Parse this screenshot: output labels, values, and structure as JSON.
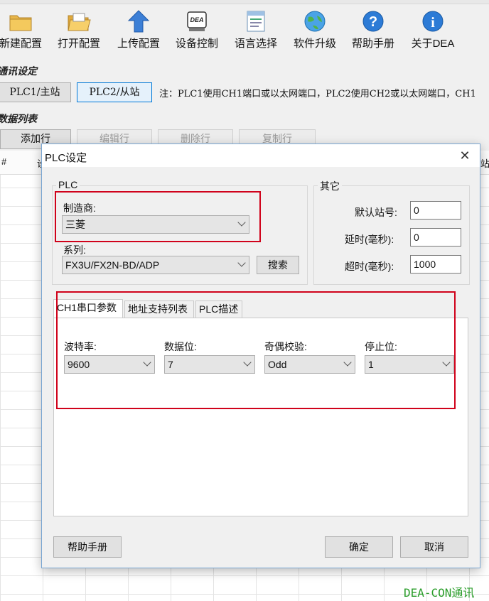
{
  "toolbar": {
    "items": [
      {
        "label": "新建配置",
        "icon": "folder-new-icon"
      },
      {
        "label": "打开配置",
        "icon": "folder-open-icon"
      },
      {
        "label": "上传配置",
        "icon": "upload-arrow-icon"
      },
      {
        "label": "设备控制",
        "icon": "dea-device-icon"
      },
      {
        "label": "语言选择",
        "icon": "language-icon"
      },
      {
        "label": "软件升级",
        "icon": "globe-icon"
      },
      {
        "label": "帮助手册",
        "icon": "help-icon"
      },
      {
        "label": "关于DEA",
        "icon": "info-icon"
      }
    ]
  },
  "comm": {
    "title": "通讯设定",
    "plc1_label": "PLC1/主站",
    "plc2_label": "PLC2/从站",
    "note": "注：PLC1使用CH1端口或以太网端口，PLC2使用CH2或以太网端口，CH1"
  },
  "datalist": {
    "title": "数据列表",
    "add_row": "添加行",
    "edit_row": "编辑行",
    "delete_row": "删除行",
    "copy_row": "复制行",
    "col_hash": "#",
    "col_partial": "设",
    "col_right_partial": "站"
  },
  "dialog": {
    "title": "PLC设定",
    "plc_group": "PLC",
    "manufacturer_label": "制造商:",
    "manufacturer_value": "三菱",
    "series_label": "系列:",
    "series_value": "FX3U/FX2N-BD/ADP",
    "search_button": "搜索",
    "other_group": "其它",
    "default_station_label": "默认站号:",
    "default_station_value": "0",
    "delay_label": "延时(毫秒):",
    "delay_value": "0",
    "timeout_label": "超时(毫秒):",
    "timeout_value": "1000",
    "tabs": [
      "CH1串口参数",
      "地址支持列表",
      "PLC描述"
    ],
    "baud_label": "波特率:",
    "baud_value": "9600",
    "databits_label": "数据位:",
    "databits_value": "7",
    "parity_label": "奇偶校验:",
    "parity_value": "Odd",
    "stopbits_label": "停止位:",
    "stopbits_value": "1",
    "help_button": "帮助手册",
    "ok_button": "确定",
    "cancel_button": "取消"
  },
  "watermark": "DEA-CON通讯",
  "colors": {
    "highlight": "#d0021b",
    "accent": "#0078d7",
    "watermark": "#2a9d2a"
  }
}
